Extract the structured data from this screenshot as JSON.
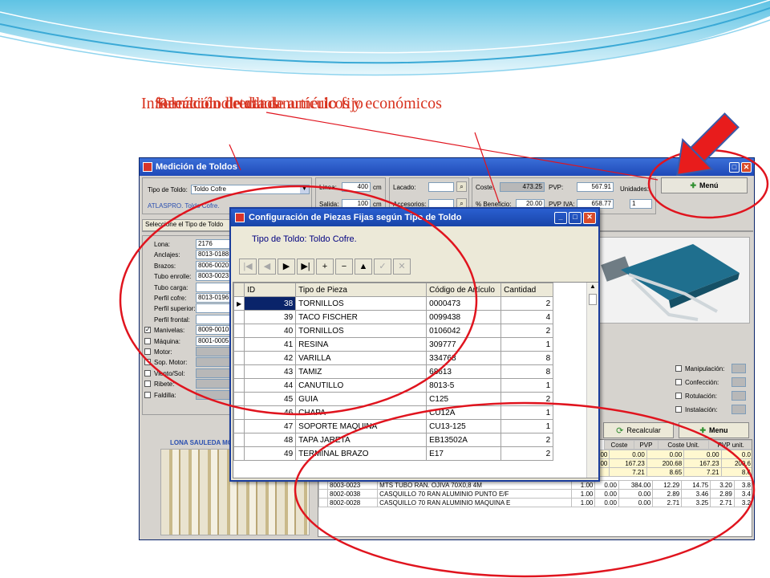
{
  "slide": {
    "title_overlap_1": "Selección directa de artículo fijo",
    "title_overlap_2": "Recálculo de datos numéricos y económicos",
    "title_overlap_3": "Información detallada"
  },
  "app": {
    "title": "Medición de Toldos",
    "tipo_label": "Tipo de Toldo:",
    "tipo_value": "Toldo Cofre",
    "model_text": "ATLASPRO. Toldo Cofre.",
    "select_tab": "Seleccione el Tipo de Toldo",
    "linea_label": "Linea:",
    "linea_value": "400",
    "linea_unit": "cm",
    "salida_label": "Salida:",
    "salida_value": "100",
    "salida_unit": "cm",
    "lacado_label": "Lacado:",
    "accesorios_label": "Accesorios:",
    "coste_label": "Coste:",
    "coste_value": "473.25",
    "pvp_label": "PVP:",
    "pvp_value": "567.91",
    "unidades_label": "Unidades:",
    "unidades_value": "1",
    "beneficio_label": "% Beneficio:",
    "beneficio_value": "20.00",
    "pvp_iva_label": "PVP IVA:",
    "pvp_iva_value": "658.77",
    "menu_top": "Menú",
    "recalcular": "Recalcular",
    "menu_bottom": "Menu",
    "lona_caption": "LONA SAULEDA MOD",
    "parts": [
      {
        "label": "Lona:",
        "value": "2176"
      },
      {
        "label": "Anclajes:",
        "value": "8013-0188"
      },
      {
        "label": "Brazos:",
        "value": "8006-0020"
      },
      {
        "label": "Tubo enrolle:",
        "value": "8003-0023"
      },
      {
        "label": "Tubo carga:",
        "value": ""
      },
      {
        "label": "Perfil cofre:",
        "value": "8013-0196"
      },
      {
        "label": "Perfil superior:",
        "value": ""
      },
      {
        "label": "Perfil frontal:",
        "value": ""
      },
      {
        "label": "Manivelas:",
        "value": "8009-0010"
      },
      {
        "label": "Máquina:",
        "value": "8001-0005"
      },
      {
        "label": "Motor:",
        "value": ""
      },
      {
        "label": "Sop. Motor:",
        "value": ""
      },
      {
        "label": "Viento/Sol:",
        "value": ""
      },
      {
        "label": "Ribete:",
        "value": ""
      },
      {
        "label": "Faldilla:",
        "value": ""
      }
    ],
    "options": [
      {
        "label": "Manipulación:"
      },
      {
        "label": "Confección:"
      },
      {
        "label": "Rotulación:"
      },
      {
        "label": "Instalación:"
      }
    ],
    "bottom_headers": [
      "Coste",
      "PVP",
      "Coste Unit.",
      "PVP unit."
    ],
    "bottom_rows_partial": [
      {
        "c0": "0.00",
        "c1": "0.00",
        "c2": "0.00",
        "c3": "0.00",
        "c4": "0.0"
      },
      {
        "c0": "0.00",
        "c1": "167.23",
        "c2": "200.68",
        "c3": "167.23",
        "c4": "200.6"
      },
      {
        "c0": "",
        "c1": "7.21",
        "c2": "8.65",
        "c3": "7.21",
        "c4": "8.6"
      }
    ],
    "bottom_rows": [
      {
        "code": "8003-0023",
        "desc": "MTS TUBO RAN. OJIVA 70X0,8 4M",
        "q1": "1.00",
        "q2": "0.00",
        "q3": "384.00",
        "coste": "12.29",
        "pvp": "14.75",
        "cu": "3.20",
        "pu": "3.8"
      },
      {
        "code": "8002-0038",
        "desc": "CASQUILLO 70 RAN ALUMINIO PUNTO E/F",
        "q1": "1.00",
        "q2": "0.00",
        "q3": "0.00",
        "coste": "2.89",
        "pvp": "3.46",
        "cu": "2.89",
        "pu": "3.4"
      },
      {
        "code": "8002-0028",
        "desc": "CASQUILLO 70 RAN ALUMINIO MAQUINA E",
        "q1": "1.00",
        "q2": "0.00",
        "q3": "0.00",
        "coste": "2.71",
        "pvp": "3.25",
        "cu": "2.71",
        "pu": "3.2"
      }
    ]
  },
  "dialog": {
    "title": "Configuración de Piezas Fijas según Tipo de Toldo",
    "subtitle": "Tipo de Toldo: Toldo Cofre.",
    "nav": [
      "|◀",
      "◀",
      "▶",
      "▶|",
      "+",
      "−",
      "▲",
      "✓",
      "✕"
    ],
    "columns": [
      "ID",
      "Tipo de Pieza",
      "Código de Artículo",
      "Cantidad"
    ],
    "rows": [
      {
        "id": "38",
        "tipo": "TORNILLOS",
        "codigo": "0000473",
        "cantidad": "2"
      },
      {
        "id": "39",
        "tipo": "TACO FISCHER",
        "codigo": "0099438",
        "cantidad": "4"
      },
      {
        "id": "40",
        "tipo": "TORNILLOS",
        "codigo": "0106042",
        "cantidad": "2"
      },
      {
        "id": "41",
        "tipo": "RESINA",
        "codigo": "309777",
        "cantidad": "1"
      },
      {
        "id": "42",
        "tipo": "VARILLA",
        "codigo": "334768",
        "cantidad": "8"
      },
      {
        "id": "43",
        "tipo": "TAMIZ",
        "codigo": "68613",
        "cantidad": "8"
      },
      {
        "id": "44",
        "tipo": "CANUTILLO",
        "codigo": "8013-5",
        "cantidad": "1"
      },
      {
        "id": "45",
        "tipo": "GUIA",
        "codigo": "C125",
        "cantidad": "2"
      },
      {
        "id": "46",
        "tipo": "CHAPA",
        "codigo": "CU12A",
        "cantidad": "1"
      },
      {
        "id": "47",
        "tipo": "SOPORTE MAQUINA",
        "codigo": "CU13-125",
        "cantidad": "1"
      },
      {
        "id": "48",
        "tipo": "TAPA JARETA",
        "codigo": "EB13502A",
        "cantidad": "2"
      },
      {
        "id": "49",
        "tipo": "TERMINAL BRAZO",
        "codigo": "E17",
        "cantidad": "2"
      }
    ]
  },
  "colors": {
    "annotation": "#e0141e",
    "title_red": "#d8321e",
    "titlebar": "#1f49b8"
  }
}
